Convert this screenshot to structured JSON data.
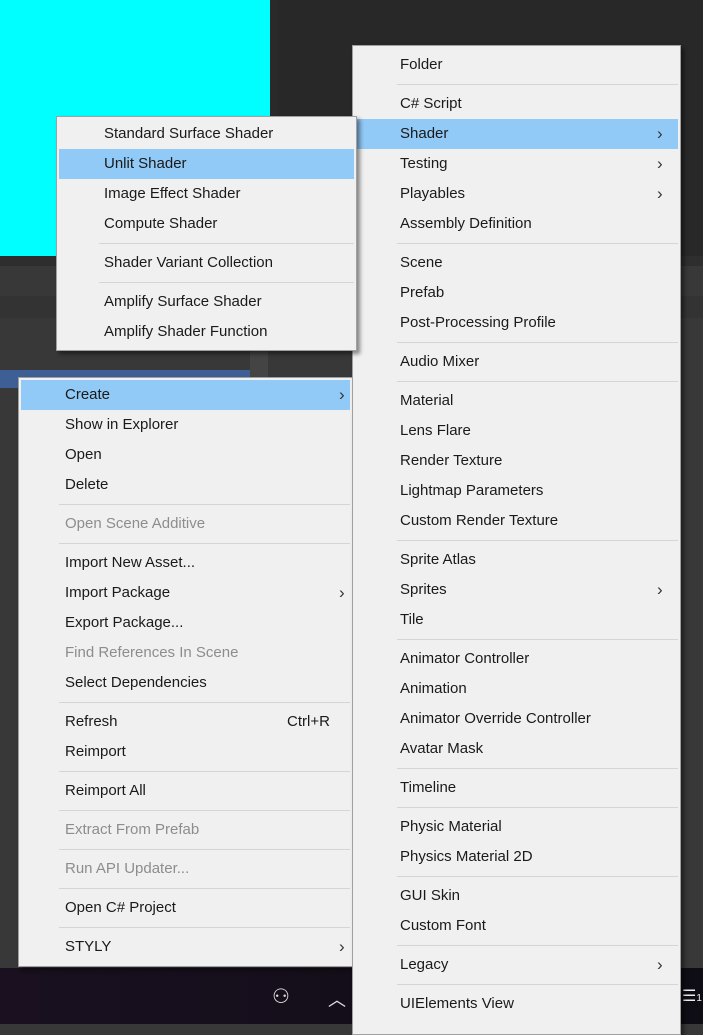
{
  "colors": {
    "highlight": "#91c9f7",
    "menu_bg": "#f0f0f0",
    "disabled": "#8d8d8d",
    "viewport": "#00ffff",
    "selection": "#3d5f96",
    "taskbar": "#150f1a"
  },
  "main_menu": {
    "items": [
      {
        "label": "Create",
        "submenu": true,
        "highlighted": true
      },
      {
        "label": "Show in Explorer"
      },
      {
        "label": "Open"
      },
      {
        "label": "Delete"
      },
      {
        "sep": true
      },
      {
        "label": "Open Scene Additive",
        "disabled": true
      },
      {
        "sep": true
      },
      {
        "label": "Import New Asset..."
      },
      {
        "label": "Import Package",
        "submenu": true
      },
      {
        "label": "Export Package..."
      },
      {
        "label": "Find References In Scene",
        "disabled": true
      },
      {
        "label": "Select Dependencies"
      },
      {
        "sep": true
      },
      {
        "label": "Refresh",
        "shortcut": "Ctrl+R"
      },
      {
        "label": "Reimport"
      },
      {
        "sep": true
      },
      {
        "label": "Reimport All"
      },
      {
        "sep": true
      },
      {
        "label": "Extract From Prefab",
        "disabled": true
      },
      {
        "sep": true
      },
      {
        "label": "Run API Updater...",
        "disabled": true
      },
      {
        "sep": true
      },
      {
        "label": "Open C# Project"
      },
      {
        "sep": true
      },
      {
        "label": "STYLY",
        "submenu": true
      }
    ]
  },
  "create_menu": {
    "items": [
      {
        "label": "Folder"
      },
      {
        "sep": true
      },
      {
        "label": "C# Script"
      },
      {
        "label": "Shader",
        "submenu": true,
        "highlighted": true
      },
      {
        "label": "Testing",
        "submenu": true
      },
      {
        "label": "Playables",
        "submenu": true
      },
      {
        "label": "Assembly Definition"
      },
      {
        "sep": true
      },
      {
        "label": "Scene"
      },
      {
        "label": "Prefab"
      },
      {
        "label": "Post-Processing Profile"
      },
      {
        "sep": true
      },
      {
        "label": "Audio Mixer"
      },
      {
        "sep": true
      },
      {
        "label": "Material"
      },
      {
        "label": "Lens Flare"
      },
      {
        "label": "Render Texture"
      },
      {
        "label": "Lightmap Parameters"
      },
      {
        "label": "Custom Render Texture"
      },
      {
        "sep": true
      },
      {
        "label": "Sprite Atlas"
      },
      {
        "label": "Sprites",
        "submenu": true
      },
      {
        "label": "Tile"
      },
      {
        "sep": true
      },
      {
        "label": "Animator Controller"
      },
      {
        "label": "Animation"
      },
      {
        "label": "Animator Override Controller"
      },
      {
        "label": "Avatar Mask"
      },
      {
        "sep": true
      },
      {
        "label": "Timeline"
      },
      {
        "sep": true
      },
      {
        "label": "Physic Material"
      },
      {
        "label": "Physics Material 2D"
      },
      {
        "sep": true
      },
      {
        "label": "GUI Skin"
      },
      {
        "label": "Custom Font"
      },
      {
        "sep": true
      },
      {
        "label": "Legacy",
        "submenu": true
      },
      {
        "sep": true
      },
      {
        "label": "UIElements View"
      }
    ]
  },
  "shader_menu": {
    "items": [
      {
        "label": "Standard Surface Shader"
      },
      {
        "label": "Unlit Shader",
        "highlighted": true
      },
      {
        "label": "Image Effect Shader"
      },
      {
        "label": "Compute Shader"
      },
      {
        "sep": true
      },
      {
        "label": "Shader Variant Collection"
      },
      {
        "sep": true
      },
      {
        "label": "Amplify Surface Shader"
      },
      {
        "label": "Amplify Shader Function"
      }
    ]
  },
  "taskbar": {
    "icons": [
      "people-icon",
      "chevron-up-icon",
      "notification-icon"
    ],
    "notification_count": "1"
  }
}
